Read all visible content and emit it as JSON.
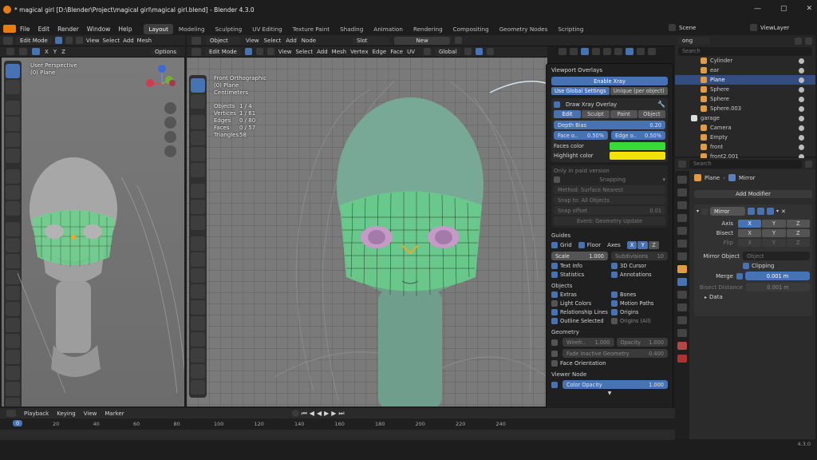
{
  "window": {
    "title": "* magical girl [D:\\Blender\\Project\\magical girl\\magical girl.blend] - Blender 4.3.0",
    "controls": [
      "—",
      "▢",
      "✕"
    ]
  },
  "menubar": {
    "items": [
      "File",
      "Edit",
      "Render",
      "Window",
      "Help"
    ],
    "workspaces": [
      "Layout",
      "Modeling",
      "Sculpting",
      "UV Editing",
      "Texture Paint",
      "Shading",
      "Animation",
      "Rendering",
      "Compositing",
      "Geometry Nodes",
      "Scripting"
    ],
    "active_workspace": "Layout",
    "scene": "Scene",
    "view_layer": "ViewLayer"
  },
  "left_viewport": {
    "mode": "Edit Mode",
    "menus": [
      "View",
      "Select",
      "Add",
      "Mesh"
    ],
    "axes": [
      "X",
      "Y",
      "Z"
    ],
    "options": "Options",
    "info": [
      "User Perspective",
      "(0) Plane"
    ]
  },
  "main_editor_header": {
    "object": "Object",
    "menus": [
      "View",
      "Select",
      "Add",
      "Node"
    ],
    "slot": "Slot",
    "new": "New"
  },
  "main_viewport": {
    "mode": "Edit Mode",
    "menus": [
      "View",
      "Select",
      "Add",
      "Mesh",
      "Vertex",
      "Edge",
      "Face",
      "UV"
    ],
    "transform": "Global",
    "info_title": [
      "Front Orthographic",
      "(0) Plane",
      "Centimeters"
    ],
    "stats": [
      {
        "label": "Objects",
        "value": "1 / 4"
      },
      {
        "label": "Vertices",
        "value": "1 / 61"
      },
      {
        "label": "Edges",
        "value": "0 / 80"
      },
      {
        "label": "Faces",
        "value": "0 / 57"
      },
      {
        "label": "Triangles",
        "value": "58"
      }
    ]
  },
  "overlay_popover": {
    "title": "Viewport Overlays",
    "enable_xray": "Enable Xray",
    "use_global": "Use Global Settings",
    "unique": "Unique (per object)",
    "draw_xray": "Draw Xray Overlay",
    "modes": [
      "Edit",
      "Sculpt",
      "Paint",
      "Object"
    ],
    "depth_bias": {
      "label": "Depth Bias",
      "value": "0.20"
    },
    "face_o": {
      "label": "Face o..",
      "value": "0.50%"
    },
    "edge_o": {
      "label": "Edge o..",
      "value": "0.50%"
    },
    "faces_color": {
      "label": "Faces color",
      "color": "#39d83b"
    },
    "highlight_color": {
      "label": "Highlight color",
      "color": "#f1e30a"
    },
    "paid_note": "Only in paid version",
    "snapping": "Snapping",
    "method": "Method: Surface Nearest",
    "snap_to": "Snap to: All Objects",
    "snap_offset": {
      "label": "Snap offset",
      "value": "0.01"
    },
    "event": "Event: Geometry Update",
    "guides": {
      "title": "Guides",
      "grid": "Grid",
      "floor": "Floor",
      "axes": "Axes",
      "axis_btns": [
        "X",
        "Y",
        "Z"
      ],
      "scale": {
        "label": "Scale",
        "value": "1.000"
      },
      "subdivisions": {
        "label": "Subdivisions",
        "value": "10"
      },
      "text_info": "Text Info",
      "cursor_3d": "3D Cursor",
      "statistics": "Statistics",
      "annotations": "Annotations"
    },
    "objects": {
      "title": "Objects",
      "extras": "Extras",
      "bones": "Bones",
      "light_colors": "Light Colors",
      "motion_paths": "Motion Paths",
      "relationship_lines": "Relationship Lines",
      "origins": "Origins",
      "outline_selected": "Outline Selected",
      "origins_all": "Origins (All)"
    },
    "geometry": {
      "title": "Geometry",
      "wireframe": {
        "label": "Wirefr..",
        "value": "1.000"
      },
      "opacity": {
        "label": "Opacity",
        "value": "1.000"
      },
      "fade": {
        "label": "Fade Inactive Geometry",
        "value": "0.400"
      },
      "face_orientation": "Face Orientation"
    },
    "viewer_node": {
      "title": "Viewer Node",
      "color_opacity": {
        "label": "Color Opacity",
        "value": "1.000"
      }
    }
  },
  "outliner": {
    "search": "Search",
    "filter_label": "ong",
    "rows": [
      {
        "name": "Cylinder",
        "sel": false,
        "indent": 1
      },
      {
        "name": "ear",
        "sel": false,
        "indent": 1
      },
      {
        "name": "Plane",
        "sel": true,
        "indent": 1
      },
      {
        "name": "Sphere",
        "sel": false,
        "indent": 1
      },
      {
        "name": "Sphere",
        "sel": false,
        "indent": 1
      },
      {
        "name": "Sphere.003",
        "sel": false,
        "indent": 1
      },
      {
        "name": "garage",
        "sel": false,
        "indent": 0
      },
      {
        "name": "Camera",
        "sel": false,
        "indent": 1
      },
      {
        "name": "Empty",
        "sel": false,
        "indent": 1
      },
      {
        "name": "front",
        "sel": false,
        "indent": 1
      },
      {
        "name": "front2.001",
        "sel": false,
        "indent": 1
      }
    ]
  },
  "properties": {
    "search": "Search",
    "breadcrumb_object": "Plane",
    "breadcrumb_modifier": "Mirror",
    "add_modifier": "Add Modifier",
    "modifier_name": "Mirror",
    "axis": {
      "label": "Axis",
      "btns": [
        "X",
        "Y",
        "Z"
      ]
    },
    "bisect": {
      "label": "Bisect",
      "btns": [
        "X",
        "Y",
        "Z"
      ]
    },
    "flip": {
      "label": "Flip",
      "btns": [
        "X",
        "Y",
        "Z"
      ]
    },
    "mirror_object": {
      "label": "Mirror Object",
      "placeholder": "Object"
    },
    "clipping": "Clipping",
    "merge": {
      "label": "Merge",
      "value": "0.001 m"
    },
    "bisect_distance": {
      "label": "Bisect Distance",
      "value": "0.001 m"
    },
    "data": "Data"
  },
  "timeline": {
    "menus": [
      "Playback",
      "Keying",
      "View",
      "Marker"
    ],
    "current_frame": "0",
    "ticks": [
      "20",
      "40",
      "60",
      "80",
      "100",
      "120",
      "140",
      "160",
      "180",
      "200",
      "220",
      "240"
    ],
    "playback_glyphs": [
      "⏮",
      "◀",
      "◀",
      "▶",
      "▶",
      "⏭"
    ]
  },
  "status": {
    "version": "4.3.0"
  },
  "colors": {
    "accent": "#4772b3",
    "mesh_green": "#6fcf8e",
    "head_teal": "#78a996"
  }
}
